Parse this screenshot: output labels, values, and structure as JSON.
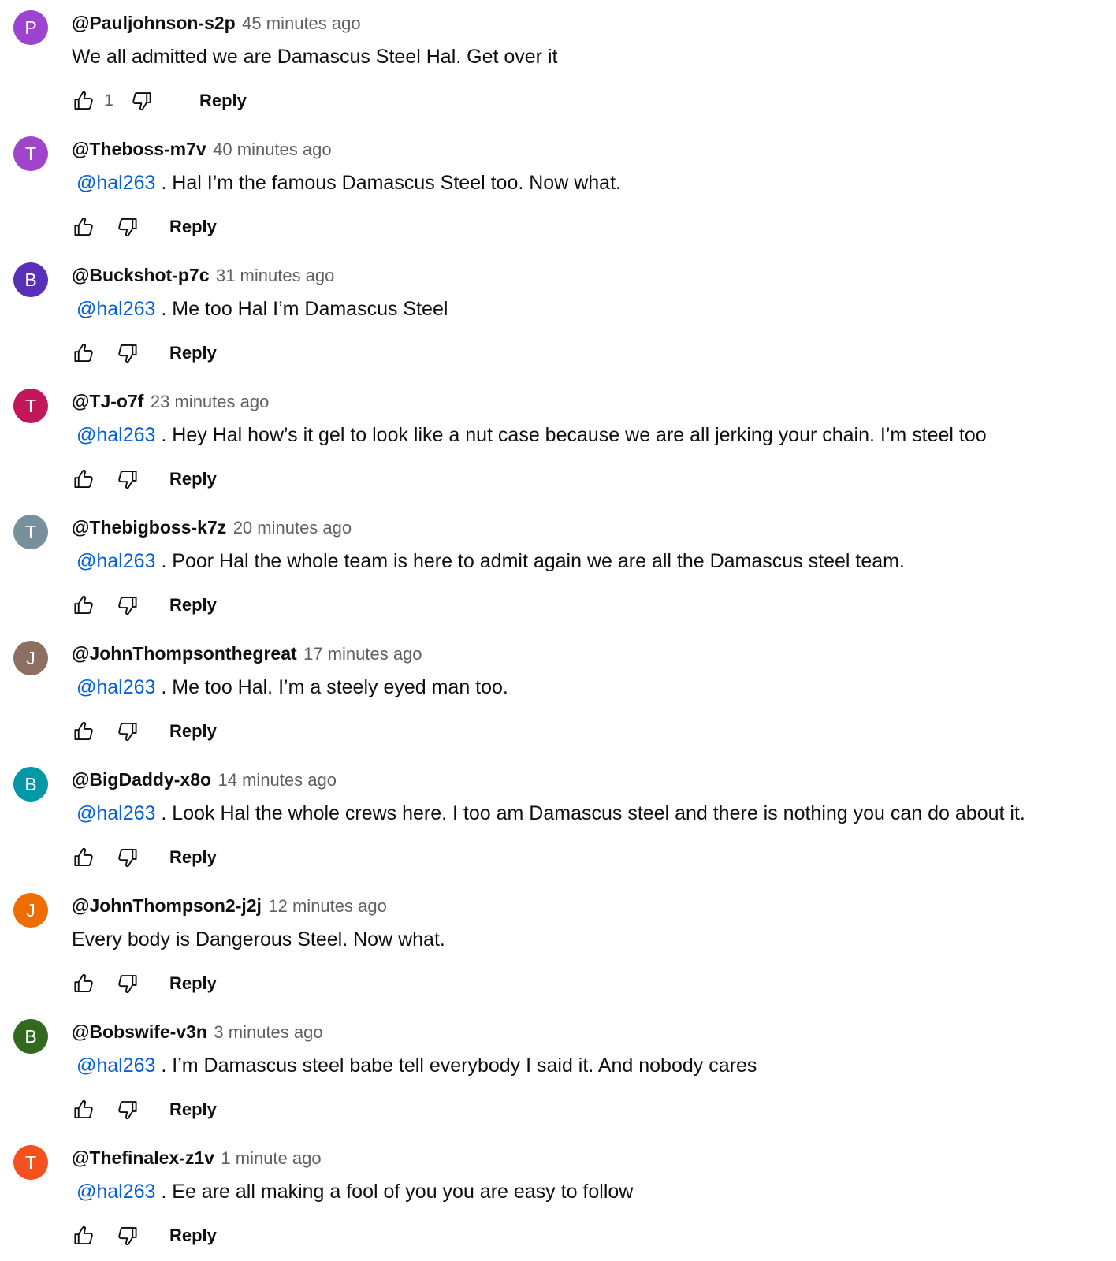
{
  "reply_label": "Reply",
  "comments": [
    {
      "avatar_letter": "P",
      "avatar_color": "#9c43cf",
      "author": "@Pauljohnson-s2p",
      "time": "45 minutes ago",
      "mention": "",
      "text": "We all admitted we are Damascus Steel Hal. Get over it",
      "likes": "1"
    },
    {
      "avatar_letter": "T",
      "avatar_color": "#a045c9",
      "author": "@Theboss-m7v",
      "time": "40 minutes ago",
      "mention": "@hal263",
      "text": " .  Hal I’m the famous Damascus Steel too. Now what.",
      "likes": ""
    },
    {
      "avatar_letter": "B",
      "avatar_color": "#5a2fb8",
      "author": "@Buckshot-p7c",
      "time": "31 minutes ago",
      "mention": "@hal263",
      "text": " .  Me too Hal I’m Damascus Steel",
      "likes": ""
    },
    {
      "avatar_letter": "T",
      "avatar_color": "#c2185b",
      "author": "@TJ-o7f",
      "time": "23 minutes ago",
      "mention": "@hal263",
      "text": " . Hey Hal how’s it gel to look like a nut case because we are all jerking your chain. I’m steel too",
      "likes": ""
    },
    {
      "avatar_letter": "T",
      "avatar_color": "#78909c",
      "author": "@Thebigboss-k7z",
      "time": "20 minutes ago",
      "mention": "@hal263",
      "text": " .  Poor Hal the whole team is here to admit again we are all the Damascus steel team.",
      "likes": ""
    },
    {
      "avatar_letter": "J",
      "avatar_color": "#8d6e63",
      "author": "@JohnThompsonthegreat",
      "time": "17 minutes ago",
      "mention": "@hal263",
      "text": " . Me too Hal. I’m a steely eyed man too.",
      "likes": ""
    },
    {
      "avatar_letter": "B",
      "avatar_color": "#0097a7",
      "author": "@BigDaddy-x8o",
      "time": "14 minutes ago",
      "mention": "@hal263",
      "text": " .  Look Hal the whole crews here. I too am Damascus steel and there is nothing you can do about it.",
      "likes": ""
    },
    {
      "avatar_letter": "J",
      "avatar_color": "#ef6c00",
      "author": "@JohnThompson2-j2j",
      "time": "12 minutes ago",
      "mention": "",
      "text": "Every body is Dangerous Steel. Now what.",
      "likes": ""
    },
    {
      "avatar_letter": "B",
      "avatar_color": "#33691e",
      "author": "@Bobswife-v3n",
      "time": "3 minutes ago",
      "mention": "@hal263",
      "text": " . I’m Damascus steel babe tell everybody I said it. And nobody cares",
      "likes": ""
    },
    {
      "avatar_letter": "T",
      "avatar_color": "#f4511e",
      "author": "@Thefinalex-z1v",
      "time": "1 minute ago",
      "mention": "@hal263",
      "text": " .  Ee are all making a fool of you you are easy to follow",
      "likes": ""
    }
  ]
}
